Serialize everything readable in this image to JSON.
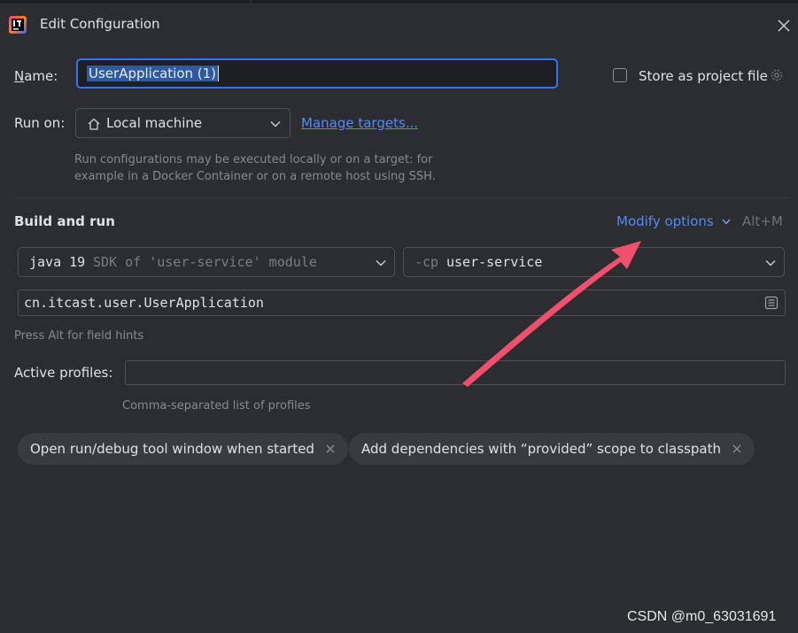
{
  "window": {
    "title": "Edit Configuration"
  },
  "form": {
    "name_label": "Name:",
    "name_value": "UserApplication (1)",
    "store_label": "Store as project file",
    "run_on_label": "Run on:",
    "run_on_value": "Local machine",
    "manage_targets": "Manage targets...",
    "run_on_hint_1": "Run configurations may be executed locally or on a target: for",
    "run_on_hint_2": "example in a Docker Container or on a remote host using SSH."
  },
  "build": {
    "section_title": "Build and run",
    "modify_options": "Modify options",
    "modify_shortcut": "Alt+M",
    "sdk_main": "java 19",
    "sdk_sub": "SDK of 'user-service' module",
    "cp_prefix": "-cp",
    "cp_value": "user-service",
    "main_class": "cn.itcast.user.UserApplication",
    "field_hint": "Press Alt for field hints"
  },
  "profiles": {
    "label": "Active profiles:",
    "value": "",
    "hint": "Comma-separated list of profiles"
  },
  "chips": [
    "Open run/debug tool window when started",
    "Add dependencies with “provided” scope to classpath"
  ],
  "watermark": "CSDN @m0_63031691",
  "colors": {
    "background": "#2b2d30",
    "accent": "#3574f0",
    "link": "#548af7",
    "annotation_arrow": "#f0506e"
  },
  "icons": [
    "intellij-app-icon",
    "close-icon",
    "gear-icon",
    "home-icon",
    "chevron-down-icon",
    "expand-text-icon",
    "chip-remove-icon"
  ]
}
